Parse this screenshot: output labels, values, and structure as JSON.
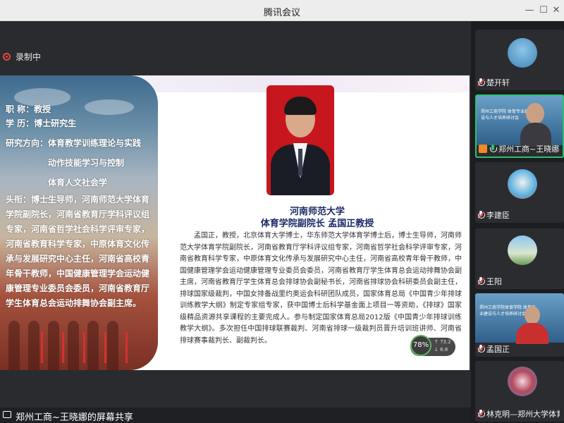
{
  "window": {
    "title": "腾讯会议"
  },
  "recording": {
    "label": "录制中"
  },
  "slide": {
    "left_lines": [
      "职  称：教授",
      "学  历：博士研究生",
      "研究方向：体育教学训练理论与实践",
      "动作技能学习与控制",
      "体育人文社会学"
    ],
    "left_paragraph": "头衔：博士生导师，河南师范大学体育学院副院长，河南省教育厅学科评议组专家，河南省哲学社会科学评审专家，河南省教育科学专家，中原体育文化传承与发展研究中心主任，河南省高校青年骨干教师，中国健康管理学会运动健康管理专业委员会委员，河南省教育厅学生体育总会运动排舞协会副主席。",
    "heading_line1": "河南师范大学",
    "heading_line2": "体育学院副院长   孟国正教授",
    "bio": "孟国正，教授，北京体育大学博士，华东师范大学体育学博士后，博士生导师，河南师范大学体育学院副院长，河南省教育厅学科评议组专家，河南省哲学社会科学评审专家，河南省教育科学专家，中原体育文化传承与发展研究中心主任，河南省高校青年骨干教师，中国健康管理学会运动健康管理专业委员会委员，河南省教育厅学生体育总会运动排舞协会副主席，河南省教育厅学生体育总会排球协会副秘书长，河南省排球协会科研委员会副主任，排球国家级裁判，中国女排备战里约奥运会科研团队成员，国家体育总局《中国青少年排球训练教学大纲》制定专家组专家，获中国博士后科学基金面上项目一等资助，《排球》国家级精品资源共享课程的主要完成人。参与制定国家体育总局2012版《中国青少年排球训练教学大纲》。多次担任中国排球联赛裁判、河南省排球一级裁判员晋升培训班讲师、河南省排球赛事裁判长、副裁判长。"
  },
  "network_widget": {
    "percent": "78%",
    "up": "↑ 73.2",
    "down": "↓ 6.8"
  },
  "share_bar": {
    "label": "郑州工商~王晓娜的屏幕共享"
  },
  "participants": [
    {
      "name": "楚开轩",
      "mic": "muted"
    },
    {
      "name": "郑州工商~王晓娜",
      "mic": "on",
      "video_caption": "郑州工商学院 体育专业建设与人才培养研讨会"
    },
    {
      "name": "李建臣",
      "mic": "muted"
    },
    {
      "name": "王阳",
      "mic": "muted"
    },
    {
      "name": "孟国正",
      "mic": "muted",
      "video_caption": "郑州工商学院体育学院 体育专业建设与人才培养研讨会"
    },
    {
      "name": "林克明—郑州大学体育学院...",
      "mic": "muted"
    }
  ],
  "colors": {
    "active_border": "#2fbf71",
    "record_red": "#e5483f",
    "heading_navy": "#1a2a66",
    "portrait_red": "#c7161e"
  }
}
